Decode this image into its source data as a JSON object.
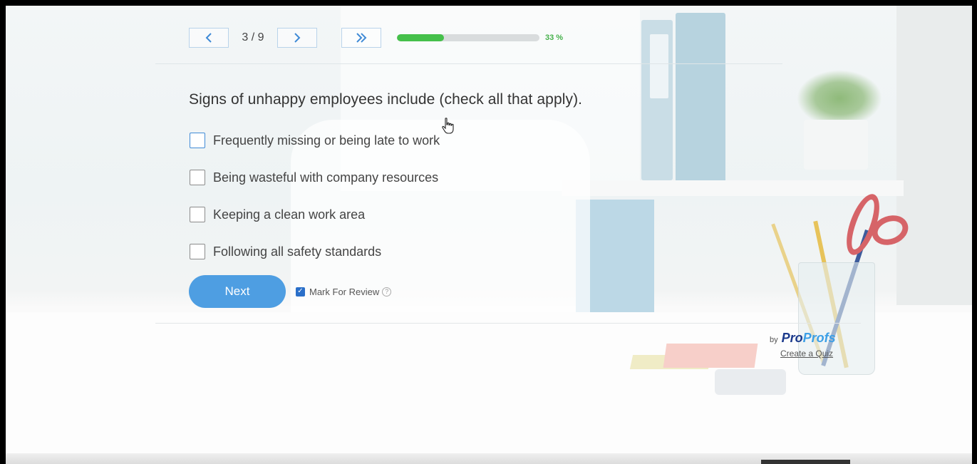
{
  "navigation": {
    "current": "3 / 9",
    "progress_percent": 33,
    "progress_label": "33 %"
  },
  "question": {
    "text": "Signs of unhappy employees include (check all that apply)."
  },
  "options": [
    {
      "label": "Frequently missing or being late to work",
      "checked": false
    },
    {
      "label": "Being wasteful with company resources",
      "checked": false
    },
    {
      "label": "Keeping a clean work area",
      "checked": false
    },
    {
      "label": "Following all safety standards",
      "checked": false
    }
  ],
  "actions": {
    "next_label": "Next",
    "review_label": "Mark For Review",
    "review_checked": true,
    "help_glyph": "?"
  },
  "branding": {
    "by": "by",
    "name_part1": "Pro",
    "name_part2": "Profs",
    "create_label": "Create a Quiz"
  },
  "colors": {
    "accent": "#4e9ee2",
    "progress": "#45c04a",
    "brand_dark": "#1b3a8c",
    "brand_light": "#3c9fe6"
  },
  "icons": {
    "prev": "chevron-left-icon",
    "next": "chevron-right-icon",
    "skip": "double-chevron-right-icon",
    "help": "question-circle-icon",
    "cursor": "hand-pointer-icon"
  }
}
